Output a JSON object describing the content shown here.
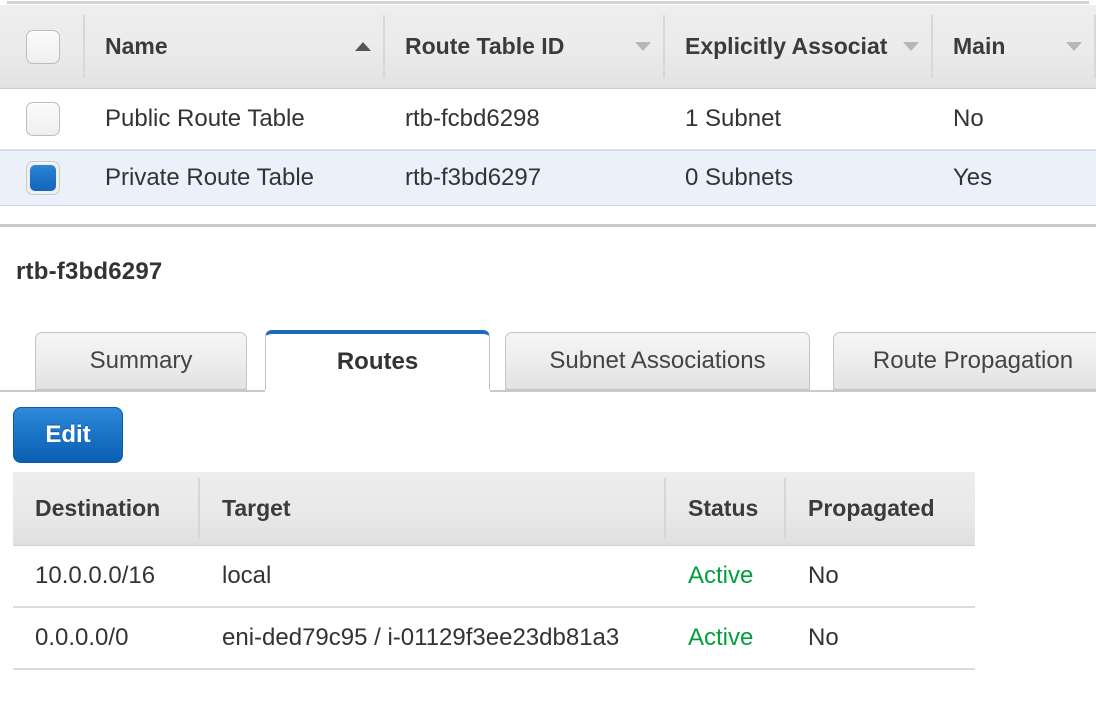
{
  "route_table_list": {
    "columns": [
      {
        "key": "checkbox",
        "label": "",
        "icon": "checkbox-icon"
      },
      {
        "key": "name",
        "label": "Name",
        "icon": "sort-ascending-icon"
      },
      {
        "key": "route_table_id",
        "label": "Route Table ID",
        "icon": "chevron-down-icon"
      },
      {
        "key": "explicitly_associated",
        "label": "Explicitly Associat",
        "icon": "chevron-down-icon"
      },
      {
        "key": "main",
        "label": "Main",
        "icon": "chevron-down-icon"
      }
    ],
    "rows": [
      {
        "selected": false,
        "name": "Public Route Table",
        "route_table_id": "rtb-fcbd6298",
        "explicitly_associated": "1 Subnet",
        "main": "No"
      },
      {
        "selected": true,
        "name": "Private Route Table",
        "route_table_id": "rtb-f3bd6297",
        "explicitly_associated": "0 Subnets",
        "main": "Yes"
      }
    ]
  },
  "detail": {
    "title": "rtb-f3bd6297",
    "tabs": [
      {
        "label": "Summary",
        "active": false
      },
      {
        "label": "Routes",
        "active": true
      },
      {
        "label": "Subnet Associations",
        "active": false
      },
      {
        "label": "Route Propagation",
        "active": false
      }
    ],
    "edit_button": "Edit",
    "routes_table": {
      "columns": [
        "Destination",
        "Target",
        "Status",
        "Propagated"
      ],
      "rows": [
        {
          "destination": "10.0.0.0/16",
          "target": "local",
          "status": "Active",
          "propagated": "No"
        },
        {
          "destination": "0.0.0.0/0",
          "target": "eni-ded79c95 / i-01129f3ee23db81a3",
          "status": "Active",
          "propagated": "No"
        }
      ]
    }
  },
  "colors": {
    "accent_blue": "#1a6bbd",
    "button_blue": "#1b74c6",
    "status_green": "#00a03c",
    "selected_row": "#eaf1fb",
    "header_gray": "#ebebeb"
  }
}
